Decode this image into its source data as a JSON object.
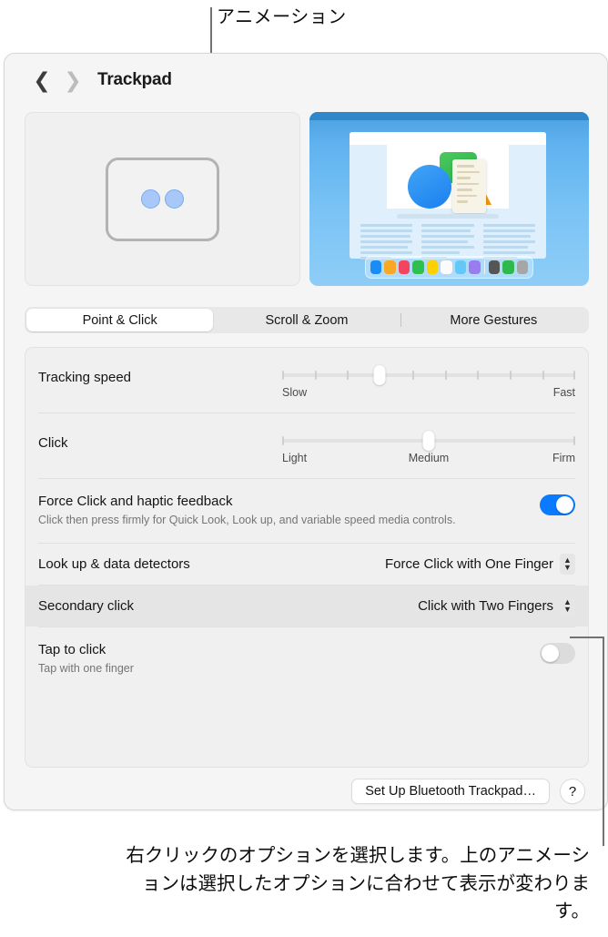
{
  "callouts": {
    "top_label": "アニメーション",
    "bottom_caption": "右クリックのオプションを選択します。上のアニメーションは選択したオプションに合わせて表示が変わります。",
    "line_color": "#737373"
  },
  "window": {
    "title": "Trackpad",
    "nav": {
      "back_icon": "chevron-left-icon",
      "forward_icon": "chevron-right-icon"
    }
  },
  "preview": {
    "animation_pane": {
      "name": "trackpad-animation",
      "finger_count": 2,
      "finger_color": "#a7c8f8"
    },
    "desktop_pane": {
      "name": "desktop-preview",
      "background_color": "#5fb2ef",
      "dock_icons": [
        "#1a8cf5",
        "#f9a826",
        "#f4455e",
        "#2ec04e",
        "#fdd000",
        "#fbfbfb",
        "#63c8f5",
        "#9a7cf0",
        "separator",
        "#555555",
        "#2eb84d",
        "#a6a6a6"
      ]
    }
  },
  "tabs": {
    "items": [
      {
        "label": "Point & Click",
        "active": true
      },
      {
        "label": "Scroll & Zoom",
        "active": false
      },
      {
        "label": "More Gestures",
        "active": false
      }
    ]
  },
  "settings": {
    "tracking_speed": {
      "label": "Tracking speed",
      "min_label": "Slow",
      "max_label": "Fast",
      "tick_count": 10,
      "value_index": 3,
      "value_percent": 33
    },
    "click": {
      "label": "Click",
      "min_label": "Light",
      "mid_label": "Medium",
      "max_label": "Firm",
      "value_percent": 50
    },
    "force_click": {
      "label": "Force Click and haptic feedback",
      "description": "Click then press firmly for Quick Look, Look up, and variable speed media controls.",
      "enabled": true,
      "toggle_on_color": "#0a7aff"
    },
    "look_up": {
      "label": "Look up & data detectors",
      "value": "Force Click with One Finger",
      "stepper_icon": "chevron-up-down-icon"
    },
    "secondary_click": {
      "label": "Secondary click",
      "value": "Click with Two Fingers",
      "stepper_icon": "chevron-up-down-icon",
      "highlighted": true
    },
    "tap_to_click": {
      "label": "Tap to click",
      "description": "Tap with one finger",
      "enabled": false
    }
  },
  "footer": {
    "setup_button": "Set Up Bluetooth Trackpad…",
    "help_button": "?"
  }
}
